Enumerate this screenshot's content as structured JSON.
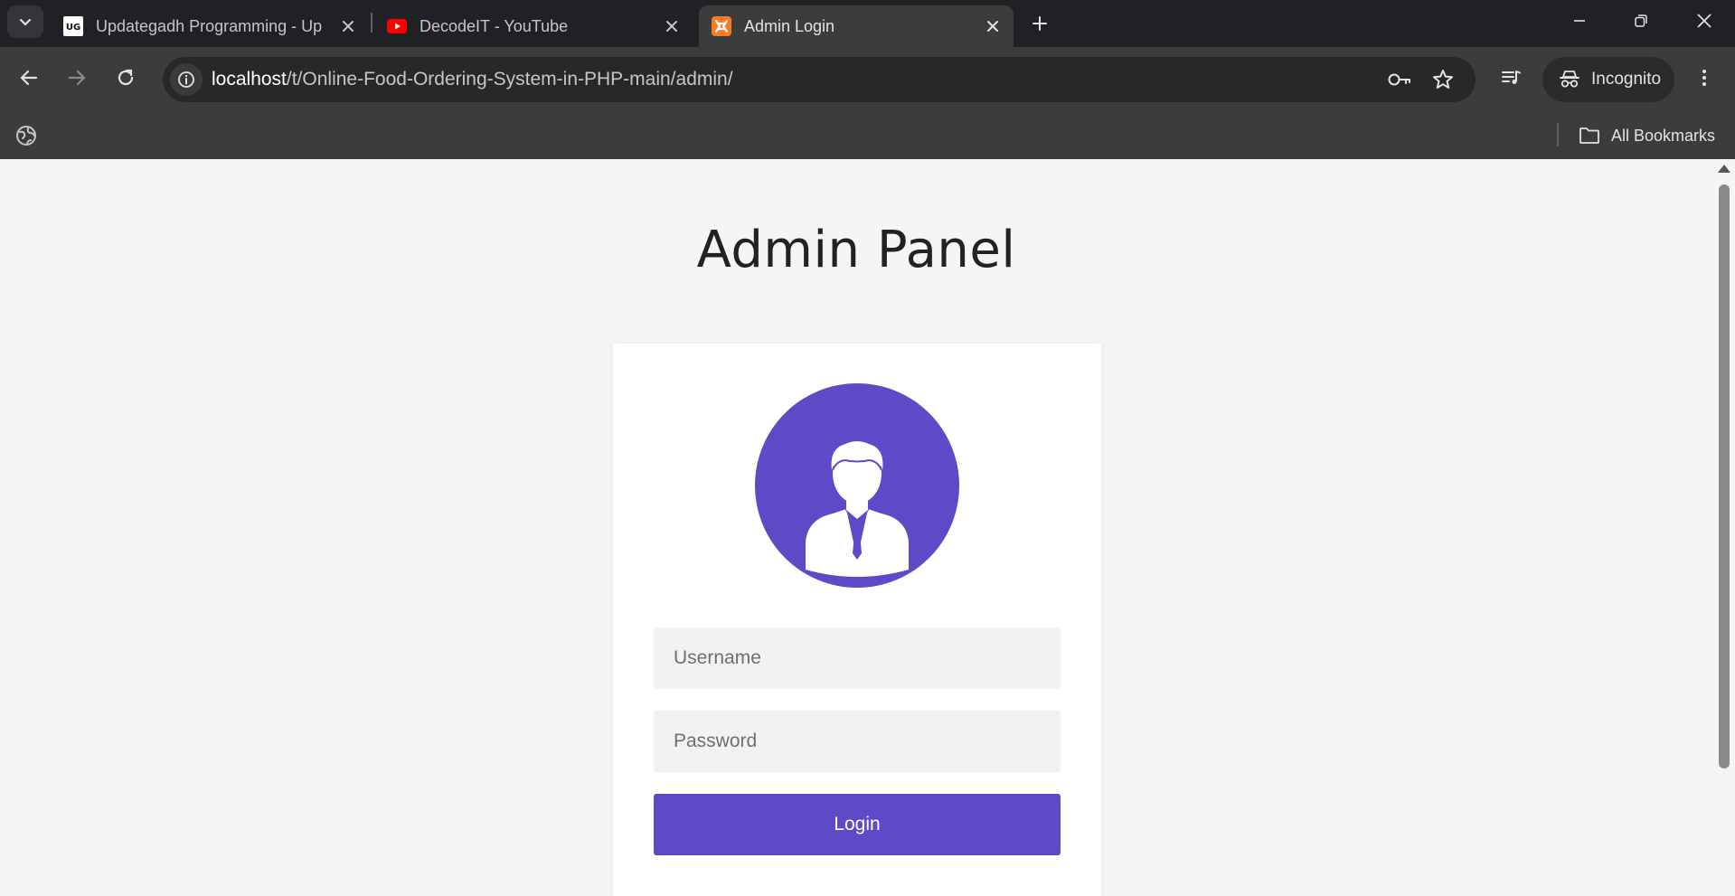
{
  "browser": {
    "tabs": [
      {
        "title": "Updategadh Programming - Up",
        "favicon": "updategadh-logo-icon",
        "favicon_text": "UG",
        "active": false
      },
      {
        "title": "DecodeIT - YouTube",
        "favicon": "youtube-icon",
        "active": false
      },
      {
        "title": "Admin Login",
        "favicon": "xampp-icon",
        "active": true
      }
    ],
    "address": {
      "host": "localhost",
      "path": "/t/Online-Food-Ordering-System-in-PHP-main/admin/"
    },
    "incognito_label": "Incognito",
    "bookmarks": {
      "all_label": "All Bookmarks"
    },
    "colors": {
      "frame": "#202124",
      "toolbar": "#3c3c3c"
    }
  },
  "page": {
    "title": "Admin Panel",
    "username_placeholder": "Username",
    "password_placeholder": "Password",
    "login_label": "Login",
    "colors": {
      "accent": "#5c4ac7",
      "background": "#f5f5f5"
    }
  }
}
